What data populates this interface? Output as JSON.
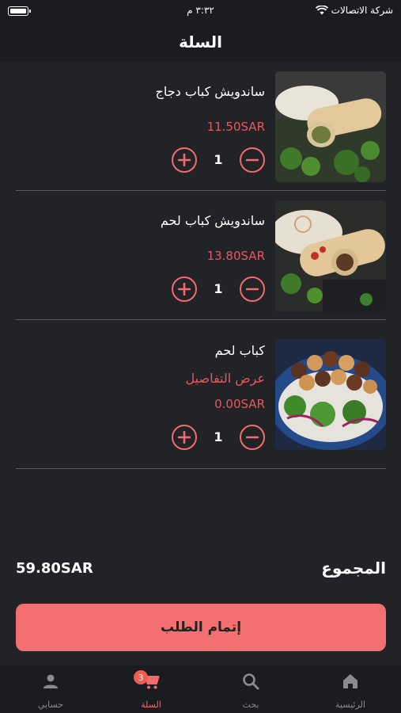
{
  "status_bar": {
    "carrier": "شركة الاتصالات",
    "time": "٣:٣٢ م"
  },
  "header": {
    "title": "السلة"
  },
  "items": [
    {
      "name": "ساندويش كباب دجاج",
      "price": "11.50SAR",
      "quantity": "1",
      "image_icon": "chicken-kebab-sandwich-photo"
    },
    {
      "name": "ساندويش كباب لحم",
      "price": "13.80SAR",
      "quantity": "1",
      "image_icon": "meat-kebab-sandwich-photo"
    },
    {
      "name": "كباب لحم",
      "details_link": "عرض التفاصيل",
      "price": "0.00SAR",
      "quantity": "1",
      "image_icon": "meat-kebab-plate-photo"
    }
  ],
  "summary": {
    "total_label": "المجموع",
    "total_value": "59.80SAR"
  },
  "checkout_label": "إتمام الطلب",
  "tabs": [
    {
      "label": "الرئيسية",
      "icon": "home-icon"
    },
    {
      "label": "بحث",
      "icon": "search-icon"
    },
    {
      "label": "السلة",
      "icon": "cart-icon",
      "badge": "3",
      "active": true
    },
    {
      "label": "حسابي",
      "icon": "person-icon"
    }
  ],
  "colors": {
    "accent": "#f36b6e",
    "price": "#e35a5f",
    "checkout_bg": "#f46f6f",
    "background": "#222326",
    "bar_bg": "#1b1c1f"
  }
}
